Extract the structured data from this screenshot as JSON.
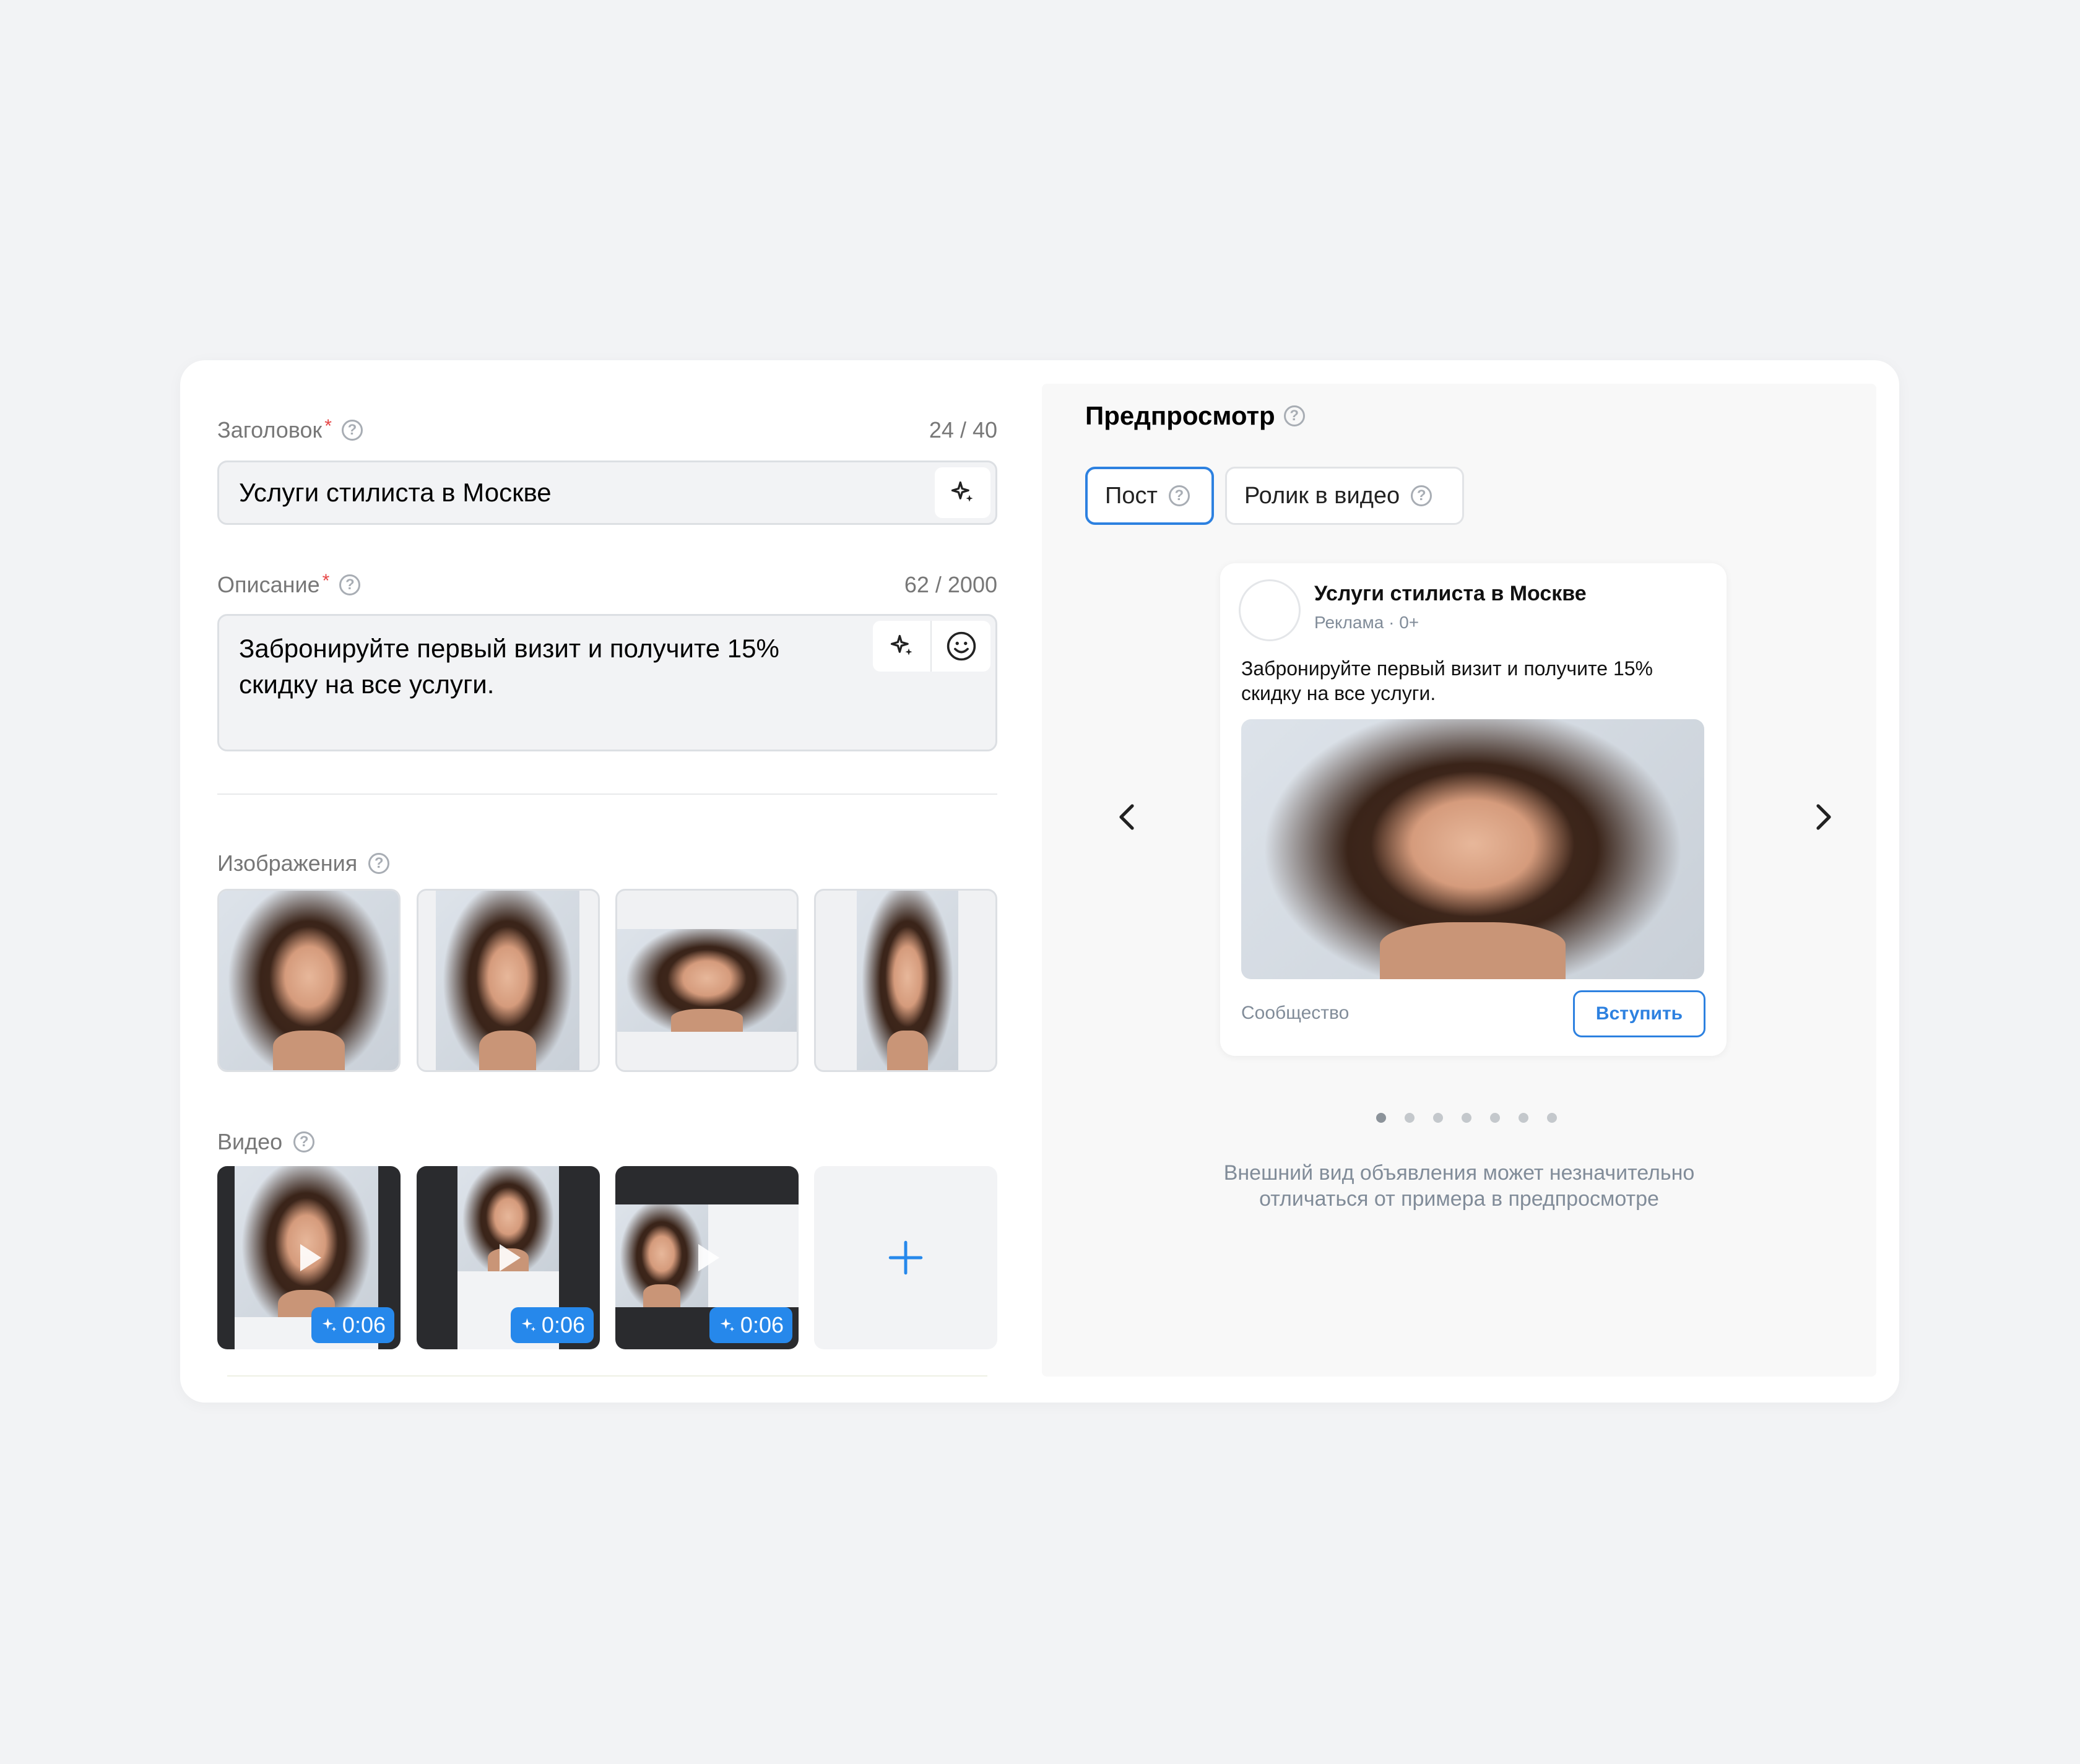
{
  "form": {
    "title_field": {
      "label": "Заголовок",
      "required_mark": "*",
      "counter": "24 / 40",
      "value": "Услуги стилиста в Москве"
    },
    "description_field": {
      "label": "Описание",
      "required_mark": "*",
      "counter": "62 / 2000",
      "value_line1": "Забронируйте первый визит и получите 15%",
      "value_line2": "скидку на все услуги."
    },
    "images": {
      "label": "Изображения"
    },
    "videos": {
      "label": "Видео",
      "items": [
        {
          "duration": "0:06"
        },
        {
          "duration": "0:06"
        },
        {
          "duration": "0:06"
        }
      ]
    },
    "help_glyph": "?"
  },
  "preview": {
    "title": "Предпросмотр",
    "tabs": [
      {
        "label": "Пост",
        "active": true
      },
      {
        "label": "Ролик в видео",
        "active": false
      }
    ],
    "post": {
      "name": "Услуги стилиста в Москве",
      "meta": "Реклама · 0+",
      "text_line1": "Забронируйте первый визит и получите 15%",
      "text_line2": "скидку на все услуги.",
      "community": "Сообщество",
      "join_label": "Вступить"
    },
    "pagination": {
      "count": 7,
      "active_index": 0
    },
    "note_line1": "Внешний вид объявления может незначительно",
    "note_line2": "отличаться от примера в предпросмотре"
  },
  "colors": {
    "accent": "#2688eb",
    "required": "#e64646",
    "page_bg": "#f2f3f5"
  },
  "icons": [
    "help-icon",
    "sparkle-icon",
    "emoji-icon",
    "play-icon",
    "plus-icon",
    "chevron-left-icon",
    "chevron-right-icon"
  ]
}
